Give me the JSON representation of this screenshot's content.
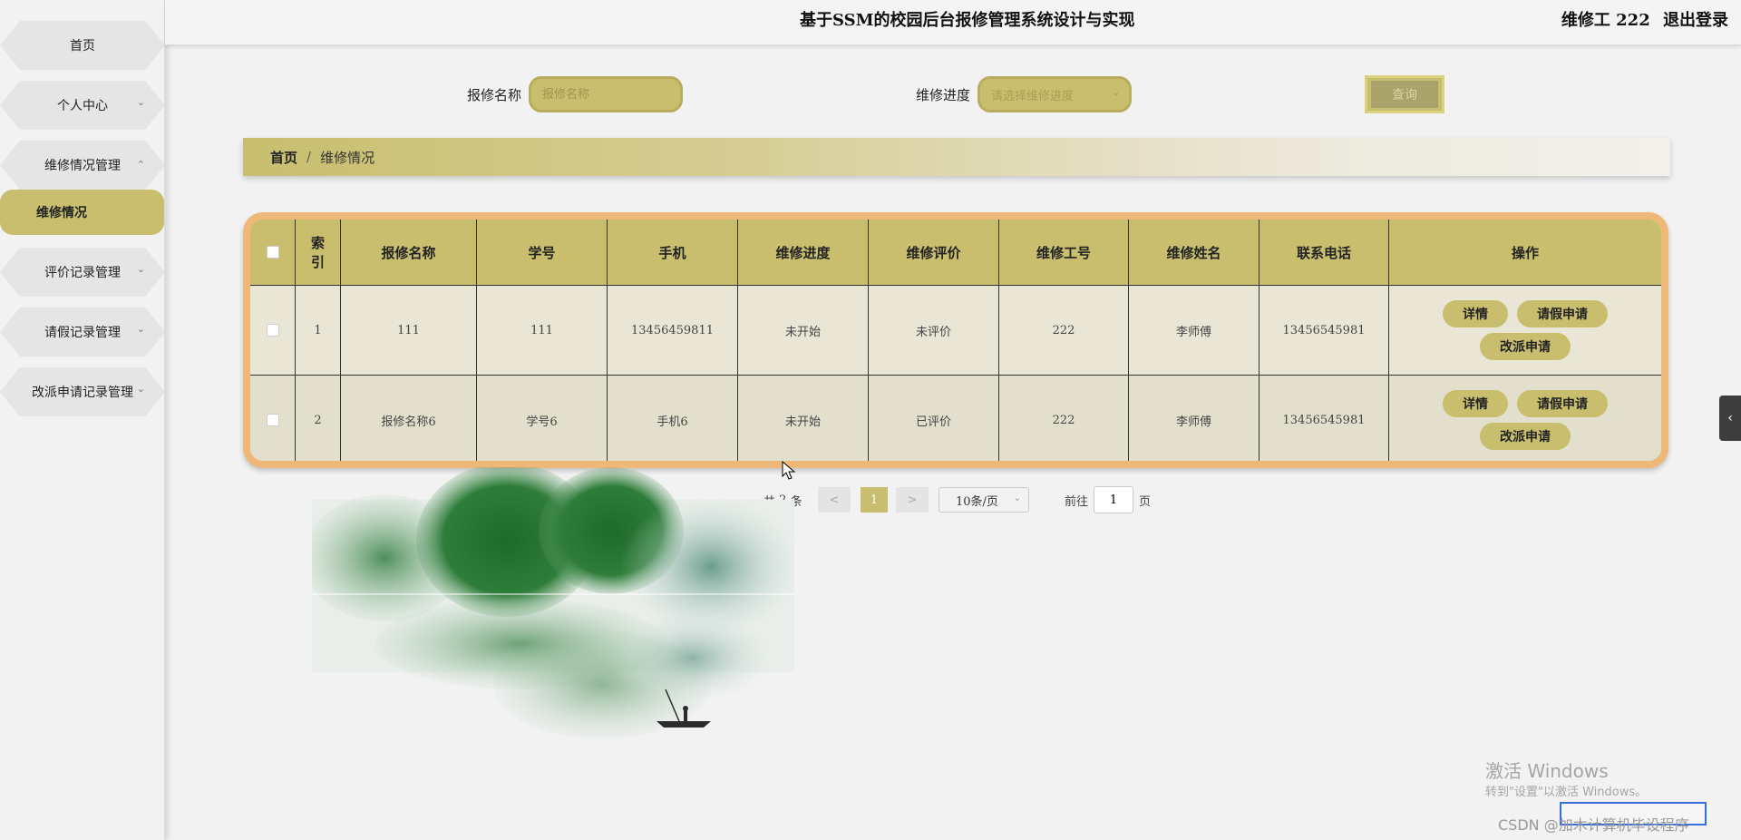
{
  "app": {
    "title": "基于SSM的校园后台报修管理系统设计与实现",
    "user_label": "维修工 222",
    "logout_label": "退出登录"
  },
  "sidebar": {
    "items": [
      {
        "label": "首页"
      },
      {
        "label": "个人中心"
      },
      {
        "label": "维修情况管理"
      },
      {
        "label": "维修情况"
      },
      {
        "label": "评价记录管理"
      },
      {
        "label": "请假记录管理"
      },
      {
        "label": "改派申请记录管理"
      }
    ]
  },
  "search": {
    "name_label": "报修名称",
    "name_placeholder": "报修名称",
    "progress_label": "维修进度",
    "progress_placeholder": "请选择维修进度",
    "query_label": "查询"
  },
  "breadcrumb": {
    "home": "首页",
    "sep": "/",
    "current": "维修情况"
  },
  "table": {
    "headers": [
      "索引",
      "报修名称",
      "学号",
      "手机",
      "维修进度",
      "维修评价",
      "维修工号",
      "维修姓名",
      "联系电话",
      "操作"
    ],
    "rows": [
      [
        "1",
        "111",
        "111",
        "13456459811",
        "未开始",
        "未评价",
        "222",
        "李师傅",
        "13456545981"
      ],
      [
        "2",
        "报修名称6",
        "学号6",
        "手机6",
        "未开始",
        "已评价",
        "222",
        "李师傅",
        "13456545981"
      ]
    ],
    "actions": {
      "detail": "详情",
      "leave": "请假申请",
      "reassign": "改派申请"
    }
  },
  "pagination": {
    "total_prefix": "共",
    "total": "2",
    "total_suffix": "条",
    "prev": "<",
    "current_page": "1",
    "next": ">",
    "page_size": "10条/页",
    "goto_prefix": "前往",
    "goto_value": "1",
    "goto_suffix": "页"
  },
  "side_tab": "‹",
  "watermark": {
    "line1": "激活 Windows",
    "line2": "转到\"设置\"以激活 Windows。",
    "csdn": "CSDN @加木计算机毕设程序"
  },
  "colors": {
    "accent": "#c8be6e",
    "table_border": "#f0b878",
    "background": "#f2f2f2"
  }
}
